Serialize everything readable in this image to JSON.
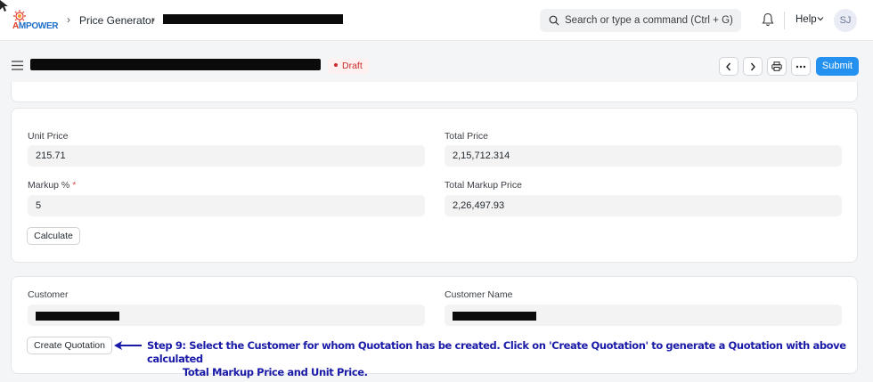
{
  "navbar": {
    "logo_text_a": "A",
    "logo_text_rest": "MPOWER",
    "breadcrumb": [
      "Price Generator"
    ],
    "search_placeholder": "Search or type a command (Ctrl + G)",
    "help_label": "Help",
    "avatar_initials": "SJ",
    "icons": [
      "bell-icon",
      "search-icon",
      "chevron-down-icon"
    ]
  },
  "page": {
    "status": "Draft",
    "submit_label": "Submit",
    "icons": [
      "menu-icon",
      "chevron-left-icon",
      "chevron-right-icon",
      "printer-icon",
      "more-icon"
    ]
  },
  "pricing": {
    "unit_price_label": "Unit Price",
    "unit_price_value": "215.71",
    "total_price_label": "Total Price",
    "total_price_value": "2,15,712.314",
    "markup_label": "Markup %",
    "markup_required": "*",
    "markup_value": "5",
    "total_markup_label": "Total Markup Price",
    "total_markup_value": "2,26,497.93",
    "calculate_label": "Calculate"
  },
  "customer": {
    "customer_label": "Customer",
    "customer_name_label": "Customer Name",
    "create_quotation_label": "Create Quotation"
  },
  "annotation": {
    "line1": "Step 9: Select the Customer for whom Quotation has be created. Click on 'Create Quotation' to generate a Quotation with above calculated",
    "line2": "Total Markup Price and Unit Price.",
    "color": "#1a1aa8"
  }
}
